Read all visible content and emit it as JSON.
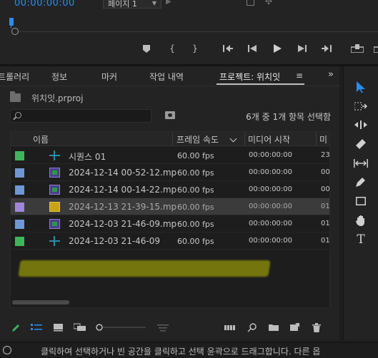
{
  "monitor": {
    "timecode": "00:00:00:00",
    "page_select": "페이지 1"
  },
  "tabs": [
    {
      "label": "컨트롤러리",
      "active": false
    },
    {
      "label": "정보",
      "active": false
    },
    {
      "label": "마커",
      "active": false
    },
    {
      "label": "작업 내역",
      "active": false
    },
    {
      "label": "프로젝트: 위치잇",
      "active": true
    }
  ],
  "project": {
    "file_name": "위치잇.prproj",
    "search_placeholder": "",
    "selection_status": "6개 중 1개 항목 선택함"
  },
  "table": {
    "headers": {
      "name": "이름",
      "frame_rate": "프레임 속도",
      "media_start": "미디어 시작",
      "extra": "미"
    },
    "rows": [
      {
        "label_color": "#3fb55b",
        "type": "sequence",
        "name": "시퀀스 01",
        "fps": "60.00 fps",
        "start": "00:00:00:00",
        "extra": "23",
        "selected": false
      },
      {
        "label_color": "#6f97d4",
        "type": "video",
        "name": "2024-12-14 00-52-12.mp",
        "fps": "60.00 fps",
        "start": "00:00:00:00",
        "extra": "00",
        "selected": false
      },
      {
        "label_color": "#6f97d4",
        "type": "video",
        "name": "2024-12-14 00-14-22.mp",
        "fps": "60.00 fps",
        "start": "00:00:00:00",
        "extra": "00",
        "selected": false
      },
      {
        "label_color": "#9f86d8",
        "type": "clip",
        "name": "2024-12-13 21-39-15.mp",
        "fps": "60.00 fps",
        "start": "00:00:00:00",
        "extra": "01",
        "selected": true
      },
      {
        "label_color": "#6f97d4",
        "type": "video",
        "name": "2024-12-03 21-46-09.mp",
        "fps": "60.00 fps",
        "start": "00:00:00:00",
        "extra": "01",
        "selected": false
      },
      {
        "label_color": "#3fb55b",
        "type": "sequence",
        "name": "2024-12-03 21-46-09",
        "fps": "60.00 fps",
        "start": "00:00:00:00",
        "extra": "01",
        "selected": false
      }
    ]
  },
  "status_bar": {
    "message": "클릭하여 선택하거나 빈 공간을 클릭하고 선택 윤곽으로 드래그합니다. 다른 옵"
  },
  "icons": {
    "tools": [
      "selection-tool",
      "track-select-tool",
      "ripple-edit-tool",
      "razor-tool",
      "slip-tool",
      "pen-tool",
      "rectangle-tool",
      "hand-tool",
      "type-tool"
    ]
  },
  "colors": {
    "accent": "#2d8ceb",
    "highlight": "#bebe00"
  }
}
